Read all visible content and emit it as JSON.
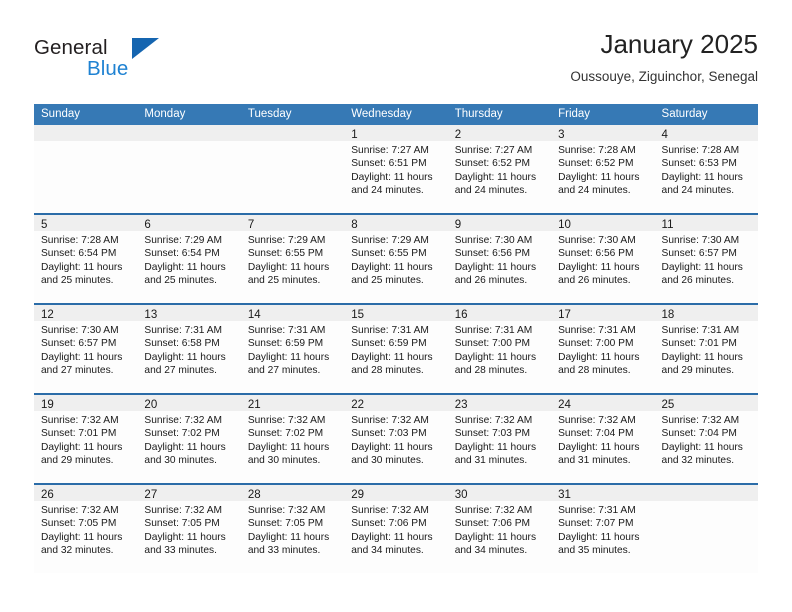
{
  "brand": {
    "word_one": "General",
    "word_two": "Blue",
    "logo_icon": "triangle-logo-icon"
  },
  "header": {
    "title": "January 2025",
    "subtitle": "Oussouye, Ziguinchor, Senegal"
  },
  "calendar": {
    "weekday_headers": [
      "Sunday",
      "Monday",
      "Tuesday",
      "Wednesday",
      "Thursday",
      "Friday",
      "Saturday"
    ],
    "header_color": "#3679b5",
    "row_separator_color": "#2b6ca8",
    "day_band_color": "#efefef",
    "weeks": [
      [
        {
          "day": "",
          "lines": []
        },
        {
          "day": "",
          "lines": []
        },
        {
          "day": "",
          "lines": []
        },
        {
          "day": "1",
          "lines": [
            "Sunrise: 7:27 AM",
            "Sunset: 6:51 PM",
            "Daylight: 11 hours",
            "and 24 minutes."
          ]
        },
        {
          "day": "2",
          "lines": [
            "Sunrise: 7:27 AM",
            "Sunset: 6:52 PM",
            "Daylight: 11 hours",
            "and 24 minutes."
          ]
        },
        {
          "day": "3",
          "lines": [
            "Sunrise: 7:28 AM",
            "Sunset: 6:52 PM",
            "Daylight: 11 hours",
            "and 24 minutes."
          ]
        },
        {
          "day": "4",
          "lines": [
            "Sunrise: 7:28 AM",
            "Sunset: 6:53 PM",
            "Daylight: 11 hours",
            "and 24 minutes."
          ]
        }
      ],
      [
        {
          "day": "5",
          "lines": [
            "Sunrise: 7:28 AM",
            "Sunset: 6:54 PM",
            "Daylight: 11 hours",
            "and 25 minutes."
          ]
        },
        {
          "day": "6",
          "lines": [
            "Sunrise: 7:29 AM",
            "Sunset: 6:54 PM",
            "Daylight: 11 hours",
            "and 25 minutes."
          ]
        },
        {
          "day": "7",
          "lines": [
            "Sunrise: 7:29 AM",
            "Sunset: 6:55 PM",
            "Daylight: 11 hours",
            "and 25 minutes."
          ]
        },
        {
          "day": "8",
          "lines": [
            "Sunrise: 7:29 AM",
            "Sunset: 6:55 PM",
            "Daylight: 11 hours",
            "and 25 minutes."
          ]
        },
        {
          "day": "9",
          "lines": [
            "Sunrise: 7:30 AM",
            "Sunset: 6:56 PM",
            "Daylight: 11 hours",
            "and 26 minutes."
          ]
        },
        {
          "day": "10",
          "lines": [
            "Sunrise: 7:30 AM",
            "Sunset: 6:56 PM",
            "Daylight: 11 hours",
            "and 26 minutes."
          ]
        },
        {
          "day": "11",
          "lines": [
            "Sunrise: 7:30 AM",
            "Sunset: 6:57 PM",
            "Daylight: 11 hours",
            "and 26 minutes."
          ]
        }
      ],
      [
        {
          "day": "12",
          "lines": [
            "Sunrise: 7:30 AM",
            "Sunset: 6:57 PM",
            "Daylight: 11 hours",
            "and 27 minutes."
          ]
        },
        {
          "day": "13",
          "lines": [
            "Sunrise: 7:31 AM",
            "Sunset: 6:58 PM",
            "Daylight: 11 hours",
            "and 27 minutes."
          ]
        },
        {
          "day": "14",
          "lines": [
            "Sunrise: 7:31 AM",
            "Sunset: 6:59 PM",
            "Daylight: 11 hours",
            "and 27 minutes."
          ]
        },
        {
          "day": "15",
          "lines": [
            "Sunrise: 7:31 AM",
            "Sunset: 6:59 PM",
            "Daylight: 11 hours",
            "and 28 minutes."
          ]
        },
        {
          "day": "16",
          "lines": [
            "Sunrise: 7:31 AM",
            "Sunset: 7:00 PM",
            "Daylight: 11 hours",
            "and 28 minutes."
          ]
        },
        {
          "day": "17",
          "lines": [
            "Sunrise: 7:31 AM",
            "Sunset: 7:00 PM",
            "Daylight: 11 hours",
            "and 28 minutes."
          ]
        },
        {
          "day": "18",
          "lines": [
            "Sunrise: 7:31 AM",
            "Sunset: 7:01 PM",
            "Daylight: 11 hours",
            "and 29 minutes."
          ]
        }
      ],
      [
        {
          "day": "19",
          "lines": [
            "Sunrise: 7:32 AM",
            "Sunset: 7:01 PM",
            "Daylight: 11 hours",
            "and 29 minutes."
          ]
        },
        {
          "day": "20",
          "lines": [
            "Sunrise: 7:32 AM",
            "Sunset: 7:02 PM",
            "Daylight: 11 hours",
            "and 30 minutes."
          ]
        },
        {
          "day": "21",
          "lines": [
            "Sunrise: 7:32 AM",
            "Sunset: 7:02 PM",
            "Daylight: 11 hours",
            "and 30 minutes."
          ]
        },
        {
          "day": "22",
          "lines": [
            "Sunrise: 7:32 AM",
            "Sunset: 7:03 PM",
            "Daylight: 11 hours",
            "and 30 minutes."
          ]
        },
        {
          "day": "23",
          "lines": [
            "Sunrise: 7:32 AM",
            "Sunset: 7:03 PM",
            "Daylight: 11 hours",
            "and 31 minutes."
          ]
        },
        {
          "day": "24",
          "lines": [
            "Sunrise: 7:32 AM",
            "Sunset: 7:04 PM",
            "Daylight: 11 hours",
            "and 31 minutes."
          ]
        },
        {
          "day": "25",
          "lines": [
            "Sunrise: 7:32 AM",
            "Sunset: 7:04 PM",
            "Daylight: 11 hours",
            "and 32 minutes."
          ]
        }
      ],
      [
        {
          "day": "26",
          "lines": [
            "Sunrise: 7:32 AM",
            "Sunset: 7:05 PM",
            "Daylight: 11 hours",
            "and 32 minutes."
          ]
        },
        {
          "day": "27",
          "lines": [
            "Sunrise: 7:32 AM",
            "Sunset: 7:05 PM",
            "Daylight: 11 hours",
            "and 33 minutes."
          ]
        },
        {
          "day": "28",
          "lines": [
            "Sunrise: 7:32 AM",
            "Sunset: 7:05 PM",
            "Daylight: 11 hours",
            "and 33 minutes."
          ]
        },
        {
          "day": "29",
          "lines": [
            "Sunrise: 7:32 AM",
            "Sunset: 7:06 PM",
            "Daylight: 11 hours",
            "and 34 minutes."
          ]
        },
        {
          "day": "30",
          "lines": [
            "Sunrise: 7:32 AM",
            "Sunset: 7:06 PM",
            "Daylight: 11 hours",
            "and 34 minutes."
          ]
        },
        {
          "day": "31",
          "lines": [
            "Sunrise: 7:31 AM",
            "Sunset: 7:07 PM",
            "Daylight: 11 hours",
            "and 35 minutes."
          ]
        },
        {
          "day": "",
          "lines": []
        }
      ]
    ]
  }
}
